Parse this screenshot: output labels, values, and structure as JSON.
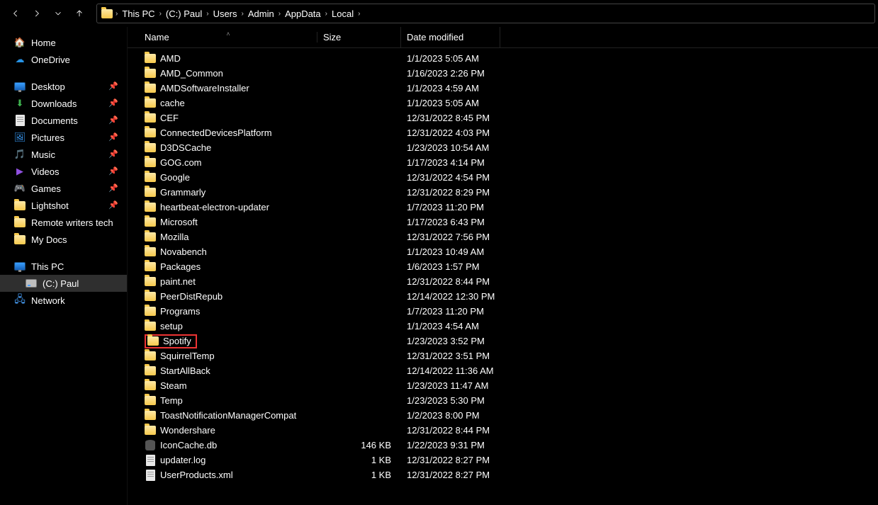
{
  "breadcrumb": [
    "This PC",
    "(C:) Paul",
    "Users",
    "Admin",
    "AppData",
    "Local"
  ],
  "columns": {
    "name": "Name",
    "size": "Size",
    "date": "Date modified"
  },
  "sidebar": {
    "home": "Home",
    "onedrive": "OneDrive",
    "quick": [
      {
        "label": "Desktop",
        "icon": "desktop"
      },
      {
        "label": "Downloads",
        "icon": "download"
      },
      {
        "label": "Documents",
        "icon": "document"
      },
      {
        "label": "Pictures",
        "icon": "picture"
      },
      {
        "label": "Music",
        "icon": "music"
      },
      {
        "label": "Videos",
        "icon": "video"
      },
      {
        "label": "Games",
        "icon": "game"
      },
      {
        "label": "Lightshot",
        "icon": "folder"
      },
      {
        "label": "Remote writers tech",
        "icon": "folder",
        "nopin": true
      },
      {
        "label": "My Docs",
        "icon": "folder",
        "nopin": true
      }
    ],
    "thispc": "This PC",
    "drive": "(C:) Paul",
    "network": "Network"
  },
  "files": [
    {
      "name": "AMD",
      "type": "folder",
      "size": "",
      "date": "1/1/2023 5:05 AM"
    },
    {
      "name": "AMD_Common",
      "type": "folder",
      "size": "",
      "date": "1/16/2023 2:26 PM"
    },
    {
      "name": "AMDSoftwareInstaller",
      "type": "folder",
      "size": "",
      "date": "1/1/2023 4:59 AM"
    },
    {
      "name": "cache",
      "type": "folder",
      "size": "",
      "date": "1/1/2023 5:05 AM"
    },
    {
      "name": "CEF",
      "type": "folder",
      "size": "",
      "date": "12/31/2022 8:45 PM"
    },
    {
      "name": "ConnectedDevicesPlatform",
      "type": "folder",
      "size": "",
      "date": "12/31/2022 4:03 PM"
    },
    {
      "name": "D3DSCache",
      "type": "folder",
      "size": "",
      "date": "1/23/2023 10:54 AM"
    },
    {
      "name": "GOG.com",
      "type": "folder",
      "size": "",
      "date": "1/17/2023 4:14 PM"
    },
    {
      "name": "Google",
      "type": "folder",
      "size": "",
      "date": "12/31/2022 4:54 PM"
    },
    {
      "name": "Grammarly",
      "type": "folder",
      "size": "",
      "date": "12/31/2022 8:29 PM"
    },
    {
      "name": "heartbeat-electron-updater",
      "type": "folder",
      "size": "",
      "date": "1/7/2023 11:20 PM"
    },
    {
      "name": "Microsoft",
      "type": "folder",
      "size": "",
      "date": "1/17/2023 6:43 PM"
    },
    {
      "name": "Mozilla",
      "type": "folder",
      "size": "",
      "date": "12/31/2022 7:56 PM"
    },
    {
      "name": "Novabench",
      "type": "folder",
      "size": "",
      "date": "1/1/2023 10:49 AM"
    },
    {
      "name": "Packages",
      "type": "folder",
      "size": "",
      "date": "1/6/2023 1:57 PM"
    },
    {
      "name": "paint.net",
      "type": "folder",
      "size": "",
      "date": "12/31/2022 8:44 PM"
    },
    {
      "name": "PeerDistRepub",
      "type": "folder",
      "size": "",
      "date": "12/14/2022 12:30 PM"
    },
    {
      "name": "Programs",
      "type": "folder",
      "size": "",
      "date": "1/7/2023 11:20 PM"
    },
    {
      "name": "setup",
      "type": "folder",
      "size": "",
      "date": "1/1/2023 4:54 AM"
    },
    {
      "name": "Spotify",
      "type": "folder",
      "size": "",
      "date": "1/23/2023 3:52 PM",
      "highlight": true
    },
    {
      "name": "SquirrelTemp",
      "type": "folder",
      "size": "",
      "date": "12/31/2022 3:51 PM"
    },
    {
      "name": "StartAllBack",
      "type": "folder",
      "size": "",
      "date": "12/14/2022 11:36 AM"
    },
    {
      "name": "Steam",
      "type": "folder",
      "size": "",
      "date": "1/23/2023 11:47 AM"
    },
    {
      "name": "Temp",
      "type": "folder",
      "size": "",
      "date": "1/23/2023 5:30 PM"
    },
    {
      "name": "ToastNotificationManagerCompat",
      "type": "folder",
      "size": "",
      "date": "1/2/2023 8:00 PM"
    },
    {
      "name": "Wondershare",
      "type": "folder",
      "size": "",
      "date": "12/31/2022 8:44 PM"
    },
    {
      "name": "IconCache.db",
      "type": "db",
      "size": "146 KB",
      "date": "1/22/2023 9:31 PM"
    },
    {
      "name": "updater.log",
      "type": "doc",
      "size": "1 KB",
      "date": "12/31/2022 8:27 PM"
    },
    {
      "name": "UserProducts.xml",
      "type": "doc",
      "size": "1 KB",
      "date": "12/31/2022 8:27 PM"
    }
  ]
}
